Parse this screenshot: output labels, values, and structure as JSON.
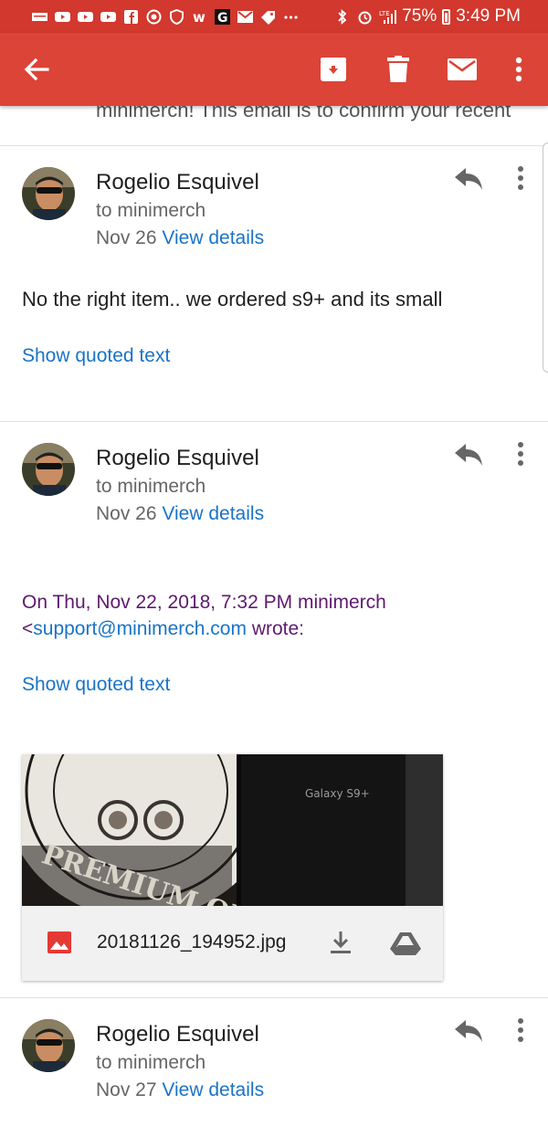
{
  "status_bar": {
    "battery": "75%",
    "time": "3:49 PM",
    "network": "LTE"
  },
  "app_bar": {
    "icons": [
      "back-arrow-icon",
      "archive-icon",
      "delete-icon",
      "mark-unread-icon",
      "more-vert-icon"
    ]
  },
  "thread": {
    "preview_text": "minimerch! This email is to confirm your recent",
    "messages": [
      {
        "sender": "Rogelio Esquivel",
        "recipient": "to minimerch",
        "date": "Nov 26",
        "details_link": "View details",
        "body": "No the right  item.. we  ordered  s9+ and its  small",
        "show_quoted": "Show quoted text"
      },
      {
        "sender": "Rogelio Esquivel",
        "recipient": "to minimerch",
        "date": "Nov 26",
        "details_link": "View details",
        "quote_attribution_line1": "On Thu, Nov 22, 2018, 7:32 PM minimerch",
        "quote_attribution_lt": "<",
        "quote_attribution_email": "support@minimerch.com",
        "quote_attribution_wrote": " wrote:",
        "show_quoted": "Show quoted text",
        "attachment": {
          "filename": "20181126_194952.jpg",
          "image_text_brand": "Galaxy S9+",
          "image_text_label": "PREMIUM QUALI"
        }
      },
      {
        "sender": "Rogelio Esquivel",
        "recipient": "to minimerch",
        "date": "Nov 27",
        "details_link": "View details"
      }
    ]
  },
  "colors": {
    "status_bar": "#d2382d",
    "app_bar": "#db4437",
    "link": "#1a73c7",
    "quote": "#5e1a6e"
  }
}
